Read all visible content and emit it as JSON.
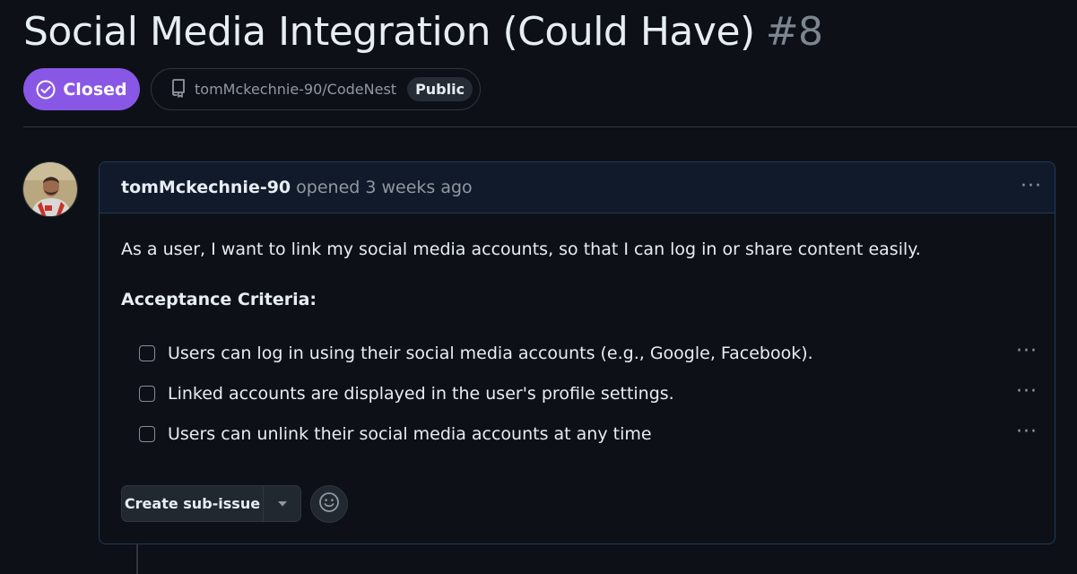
{
  "issue": {
    "title": "Social Media Integration (Could Have)",
    "number": "#8",
    "state": "Closed",
    "repo": "tomMckechnie-90/CodeNest",
    "visibility": "Public"
  },
  "comment": {
    "author": "tomMckechnie-90",
    "meta": "opened 3 weeks ago",
    "menu": "···",
    "body": "As a user, I want to link my social media accounts, so that I can log in or share content easily.",
    "heading": "Acceptance Criteria:",
    "tasks": [
      {
        "label": "Users can log in using their social media accounts (e.g., Google, Facebook).",
        "checked": false,
        "menu": "···"
      },
      {
        "label": "Linked accounts are displayed in the user's profile settings.",
        "checked": false,
        "menu": "···"
      },
      {
        "label": "Users can unlink their social media accounts at any time",
        "checked": false,
        "menu": "···"
      }
    ],
    "create_sub_issue": "Create sub-issue"
  },
  "icons": {
    "state": "check-circle-icon",
    "repo": "repo-icon",
    "caret": "triangle-down-icon",
    "emoji": "smiley-icon"
  },
  "colors": {
    "background": "#0d1117",
    "closed_badge": "#8957e5",
    "comment_header": "#111a2a",
    "comment_border": "#23395b"
  }
}
